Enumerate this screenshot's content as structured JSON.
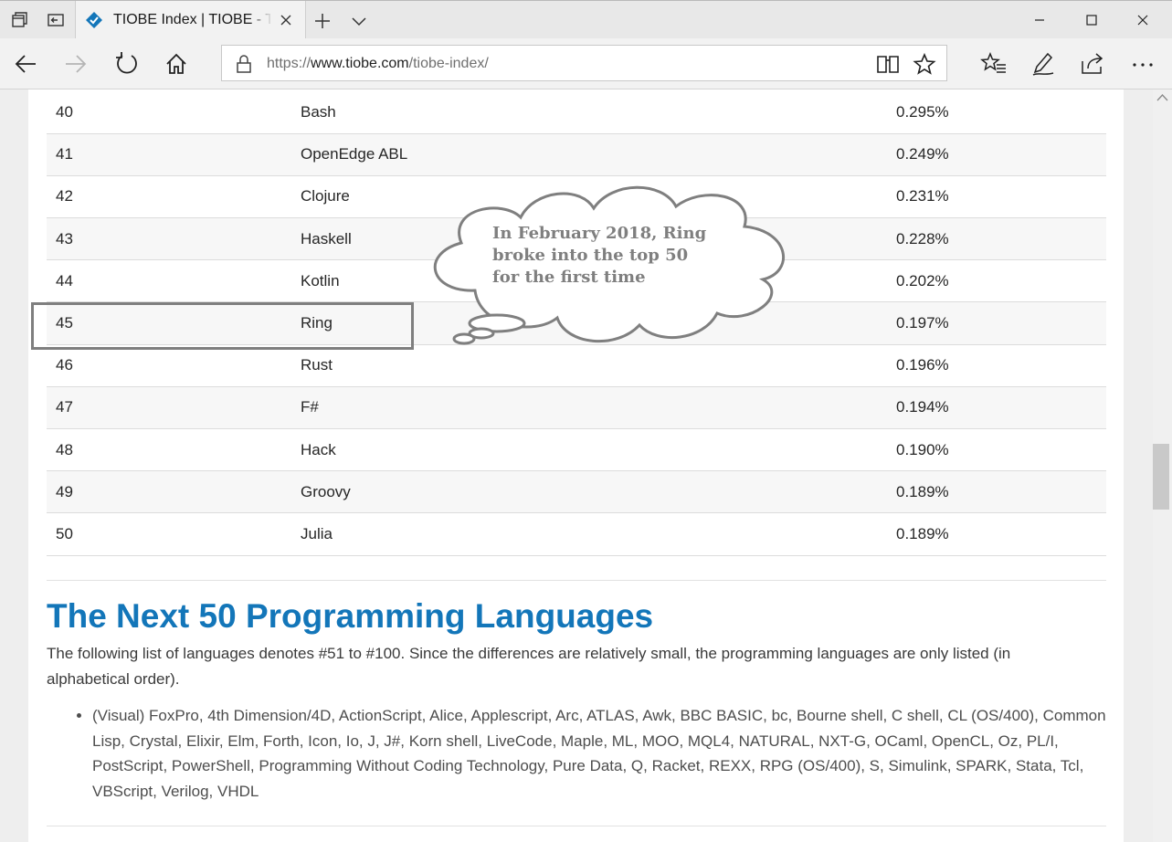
{
  "browser": {
    "tab_title": "TIOBE Index | TIOBE - The Software Quality Company",
    "url_prefix": "https://",
    "url_domain": "www.tiobe.com",
    "url_path": "/tiobe-index/",
    "icons": [
      "tab-manager-icon",
      "back-tab-icon",
      "tiobe-favicon-icon",
      "close-tab-icon",
      "new-tab-icon",
      "tab-menu-icon",
      "minimize-icon",
      "maximize-icon",
      "close-window-icon",
      "back-arrow-icon",
      "forward-arrow-icon",
      "refresh-icon",
      "home-icon",
      "lock-icon",
      "reading-view-icon",
      "favorite-star-icon",
      "favorites-hub-icon",
      "web-note-icon",
      "share-icon",
      "more-icon"
    ]
  },
  "ranking": {
    "rows": [
      {
        "rank": "40",
        "language": "Bash",
        "rating": "0.295%"
      },
      {
        "rank": "41",
        "language": "OpenEdge ABL",
        "rating": "0.249%"
      },
      {
        "rank": "42",
        "language": "Clojure",
        "rating": "0.231%"
      },
      {
        "rank": "43",
        "language": "Haskell",
        "rating": "0.228%"
      },
      {
        "rank": "44",
        "language": "Kotlin",
        "rating": "0.202%"
      },
      {
        "rank": "45",
        "language": "Ring",
        "rating": "0.197%"
      },
      {
        "rank": "46",
        "language": "Rust",
        "rating": "0.196%"
      },
      {
        "rank": "47",
        "language": "F#",
        "rating": "0.194%"
      },
      {
        "rank": "48",
        "language": "Hack",
        "rating": "0.190%"
      },
      {
        "rank": "49",
        "language": "Groovy",
        "rating": "0.189%"
      },
      {
        "rank": "50",
        "language": "Julia",
        "rating": "0.189%"
      }
    ]
  },
  "callout": {
    "lines": [
      "In February 2018, Ring",
      "broke into the top 50",
      "for the first time"
    ],
    "color": "#7f7f7f"
  },
  "next50": {
    "heading": "The Next 50 Programming Languages",
    "intro": "The following list of languages denotes #51 to #100. Since the differences are relatively small, the programming languages are only listed (in alphabetical order).",
    "languages": "(Visual) FoxPro, 4th Dimension/4D, ActionScript, Alice, Applescript, Arc, ATLAS, Awk, BBC BASIC, bc, Bourne shell, C shell, CL (OS/400), Common Lisp, Crystal, Elixir, Elm, Forth, Icon, Io, J, J#, Korn shell, LiveCode, Maple, ML, MOO, MQL4, NATURAL, NXT-G, OCaml, OpenCL, Oz, PL/I, PostScript, PowerShell, Programming Without Coding Technology, Pure Data, Q, Racket, REXX, RPG (OS/400), S, Simulink, SPARK, Stata, Tcl, VBScript, Verilog, VHDL"
  },
  "colors": {
    "heading": "#1376b9",
    "row_alt": "#f7f7f7"
  }
}
